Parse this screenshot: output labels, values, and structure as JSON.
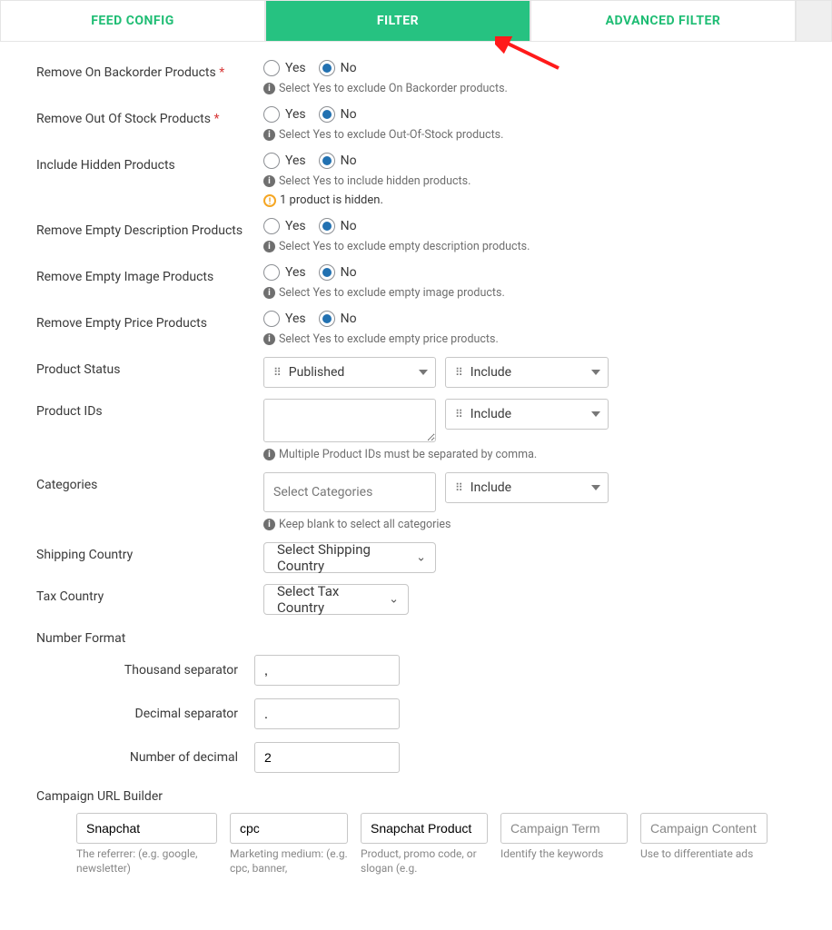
{
  "tabs": {
    "feed_config": "FEED CONFIG",
    "filter": "FILTER",
    "advanced_filter": "ADVANCED FILTER"
  },
  "labels": {
    "remove_backorder": "Remove On Backorder Products",
    "remove_outofstock": "Remove Out Of Stock Products",
    "include_hidden": "Include Hidden Products",
    "remove_empty_desc": "Remove Empty Description Products",
    "remove_empty_image": "Remove Empty Image Products",
    "remove_empty_price": "Remove Empty Price Products",
    "product_status": "Product Status",
    "product_ids": "Product IDs",
    "categories": "Categories",
    "shipping_country": "Shipping Country",
    "tax_country": "Tax Country",
    "number_format": "Number Format",
    "thousand_sep": "Thousand separator",
    "decimal_sep": "Decimal separator",
    "num_decimal": "Number of decimal",
    "campaign": "Campaign URL Builder"
  },
  "radios": {
    "yes": "Yes",
    "no": "No"
  },
  "radios_checked": {
    "remove_backorder": "no",
    "remove_outofstock": "no",
    "include_hidden": "no",
    "remove_empty_desc": "no",
    "remove_empty_image": "no",
    "remove_empty_price": "no"
  },
  "hints": {
    "backorder": "Select Yes to exclude On Backorder products.",
    "outofstock": "Select Yes to exclude Out-Of-Stock products.",
    "hidden": "Select Yes to include hidden products.",
    "hidden_warn": "1 product is hidden.",
    "empty_desc": "Select Yes to exclude empty description products.",
    "empty_image": "Select Yes to exclude empty image products.",
    "empty_price": "Select Yes to exclude empty price products.",
    "product_ids": "Multiple Product IDs must be separated by comma.",
    "categories": "Keep blank to select all categories"
  },
  "selects": {
    "product_status": "Published",
    "include": "Include",
    "categories_placeholder": "Select Categories",
    "shipping_country": "Select Shipping Country",
    "tax_country": "Select Tax Country"
  },
  "number_format": {
    "thousand": ",",
    "decimal": ".",
    "num": "2"
  },
  "utm": {
    "source": {
      "value": "Snapchat",
      "placeholder": "",
      "hint": "The referrer: (e.g. google, newsletter)"
    },
    "medium": {
      "value": "cpc",
      "placeholder": "",
      "hint": "Marketing medium: (e.g. cpc, banner,"
    },
    "campaign": {
      "value": "Snapchat Product",
      "placeholder": "",
      "hint": "Product, promo code, or slogan (e.g."
    },
    "term": {
      "value": "",
      "placeholder": "Campaign Term",
      "hint": "Identify the keywords"
    },
    "content": {
      "value": "",
      "placeholder": "Campaign Content",
      "hint": "Use to differentiate ads"
    }
  }
}
